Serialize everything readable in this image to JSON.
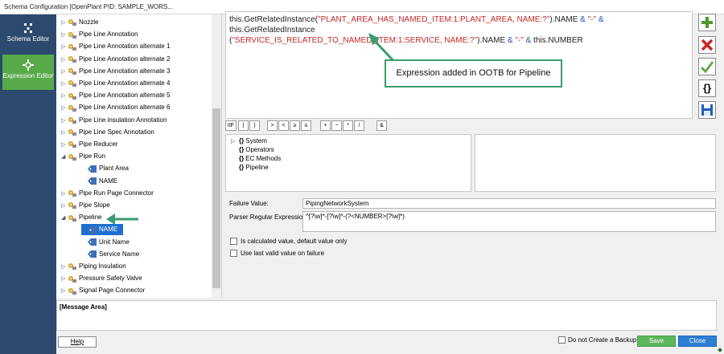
{
  "window": {
    "title": "Schema Configuration [OpenPlant PID: SAMPLE_WORS..."
  },
  "nav": [
    {
      "label": "Schema Editor"
    },
    {
      "label": "Expression Editor"
    }
  ],
  "tree": [
    {
      "label": "Nozzle",
      "exp": "▷",
      "type": "gear"
    },
    {
      "label": "Pipe Line Annotation",
      "exp": "▷",
      "type": "gear"
    },
    {
      "label": "Pipe Line Annotation alternate 1",
      "exp": "▷",
      "type": "gear"
    },
    {
      "label": "Pipe Line Annotation alternate 2",
      "exp": "▷",
      "type": "gear"
    },
    {
      "label": "Pipe Line Annotation alternate 3",
      "exp": "▷",
      "type": "gear"
    },
    {
      "label": "Pipe Line Annotation alternate 4",
      "exp": "▷",
      "type": "gear"
    },
    {
      "label": "Pipe Line Annotation alternate 5",
      "exp": "▷",
      "type": "gear"
    },
    {
      "label": "Pipe Line Annotation alternate 6",
      "exp": "▷",
      "type": "gear"
    },
    {
      "label": "Pipe Line insulation Annotation",
      "exp": "▷",
      "type": "gear"
    },
    {
      "label": "Pipe Line Spec Annotation",
      "exp": "▷",
      "type": "gear"
    },
    {
      "label": "Pipe Reducer",
      "exp": "▷",
      "type": "gear"
    },
    {
      "label": "Pipe Run",
      "exp": "◢",
      "type": "gear"
    },
    {
      "label": "Plant Area",
      "exp": "",
      "type": "tag",
      "indent": 1
    },
    {
      "label": "NAME",
      "exp": "",
      "type": "tag",
      "indent": 1
    },
    {
      "label": "Pipe Run Page Connector",
      "exp": "▷",
      "type": "gear"
    },
    {
      "label": "Pipe Slope",
      "exp": "▷",
      "type": "gear"
    },
    {
      "label": "Pipeline",
      "exp": "◢",
      "type": "gear"
    },
    {
      "label": "NAME",
      "exp": "",
      "type": "tag",
      "indent": 1,
      "selected": true
    },
    {
      "label": "Unit Name",
      "exp": "",
      "type": "tag",
      "indent": 1
    },
    {
      "label": "Service Name",
      "exp": "",
      "type": "tag",
      "indent": 1
    },
    {
      "label": "Piping Insulation",
      "exp": "▷",
      "type": "gear"
    },
    {
      "label": "Pressure Safety Valve",
      "exp": "▷",
      "type": "gear"
    },
    {
      "label": "Signal Page Connector",
      "exp": "▷",
      "type": "gear"
    }
  ],
  "expression": {
    "p1": "this.GetRelatedInstance(",
    "s1": "\"PLANT_AREA_HAS_NAMED_ITEM:1:PLANT_AREA, NAME:?\"",
    "p2": ").NAME ",
    "o1": "&",
    "s2": " \"-\" ",
    "o2": "&",
    "p3": " this.GetRelatedInstance",
    "p4": "(",
    "s3": "\"SERVICE_IS_RELATED_TO_NAMED_ITEM:1:SERVICE, NAME:?\"",
    "p5": ").NAME ",
    "o3": "&",
    "s4": " \"-\" ",
    "o4": "&",
    "p6": " this.NUMBER"
  },
  "callout": "Expression added in OOTB for Pipeline",
  "operators": [
    "IIF",
    "(",
    ")",
    ">",
    "<",
    "≥",
    "≤",
    "+",
    "−",
    "*",
    "/",
    "&"
  ],
  "functions": [
    {
      "label": "System",
      "exp": "▷"
    },
    {
      "label": "Operators",
      "exp": ""
    },
    {
      "label": "EC Methods",
      "exp": ""
    },
    {
      "label": "Pipeline",
      "exp": ""
    }
  ],
  "failure_label": "Failure Value:",
  "failure_value": "PipingNetworkSystem",
  "parser_label": "Parser Regular Expression:",
  "parser_value": "^[?\\w]*-[?\\w]*-(?<NUMBER>[?\\w]*)",
  "checkbox1": "Is calculated value, default value only",
  "checkbox2": "Use last valid value on failure",
  "message_area": "[Message Area]",
  "help": "Help",
  "backup": "Do not Create a Backup",
  "save": "Save",
  "close": "Close",
  "colors": {
    "nav_bg": "#2c4a6e",
    "nav_active": "#58a94a",
    "save_btn": "#5cb85c",
    "close_btn": "#2d7fd6",
    "selection": "#1f6fd1"
  }
}
